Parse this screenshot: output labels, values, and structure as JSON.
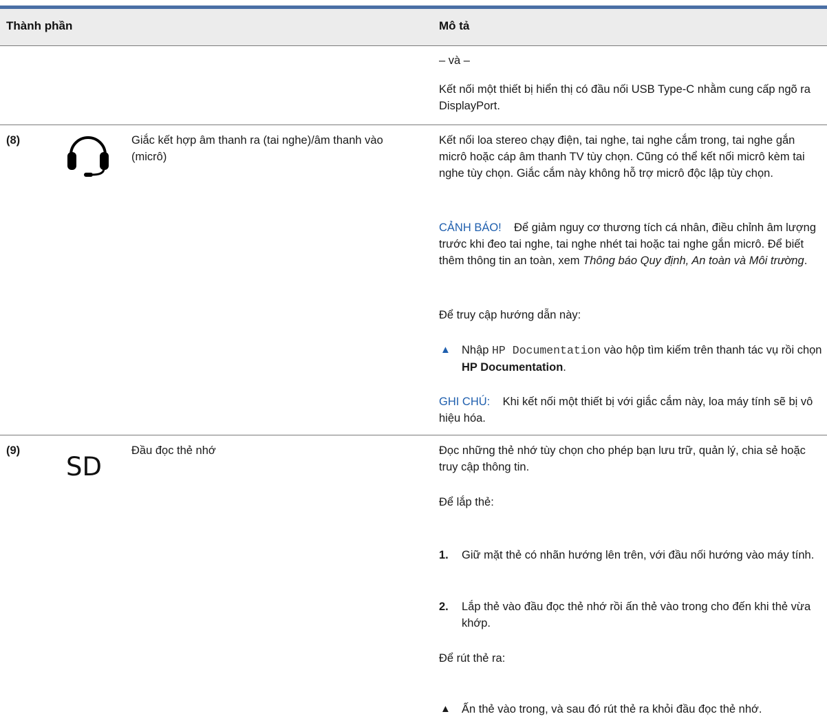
{
  "header": {
    "col_component": "Thành phần",
    "col_description": "Mô tả"
  },
  "row_prev": {
    "and_text": "– và –",
    "desc": "Kết nối một thiết bị hiển thị có đầu nối USB Type-C nhằm cung cấp ngõ ra DisplayPort."
  },
  "row8": {
    "number": "(8)",
    "icon": "headset-icon",
    "name": "Giắc kết hợp âm thanh ra (tai nghe)/âm thanh vào (micrô)",
    "desc": "Kết nối loa stereo chạy điện, tai nghe, tai nghe cắm trong, tai nghe gắn micrô hoặc cáp âm thanh TV tùy chọn. Cũng có thể kết nối micrô kèm tai nghe tùy chọn. Giắc cắm này không hỗ trợ micrô độc lập tùy chọn.",
    "warning_label": "CẢNH BÁO!",
    "warning_text": "Để giảm nguy cơ thương tích cá nhân, điều chỉnh âm lượng trước khi đeo tai nghe, tai nghe nhét tai hoặc tai nghe gắn micrô. Để biết thêm thông tin an toàn, xem ",
    "warning_ref": "Thông báo Quy định, An toàn và Môi trường",
    "warning_end": ".",
    "access_text": "Để truy cập hướng dẫn này:",
    "step_pre": "Nhập ",
    "step_code": "HP Documentation",
    "step_mid": " vào hộp tìm kiếm trên thanh tác vụ rồi chọn ",
    "step_bold": "HP Documentation",
    "step_end": ".",
    "note_label": "GHI CHÚ:",
    "note_text": "Khi kết nối một thiết bị với giắc cắm này, loa máy tính sẽ bị vô hiệu hóa."
  },
  "row9": {
    "number": "(9)",
    "icon_text": "SD",
    "name": "Đầu đọc thẻ nhớ",
    "desc": "Đọc những thẻ nhớ tùy chọn cho phép bạn lưu trữ, quản lý, chia sẻ hoặc truy cập thông tin.",
    "insert_title": "Để lắp thẻ:",
    "steps": [
      {
        "num": "1.",
        "text": "Giữ mặt thẻ có nhãn hướng lên trên, với đầu nối hướng vào máy tính."
      },
      {
        "num": "2.",
        "text": "Lắp thẻ vào đầu đọc thẻ nhớ rồi ấn thẻ vào trong cho đến khi thẻ vừa khớp."
      }
    ],
    "remove_title": "Để rút thẻ ra:",
    "remove_step": "Ấn thẻ vào trong, và sau đó rút thẻ ra khỏi đầu đọc thẻ nhớ."
  },
  "colors": {
    "accent": "#1f5fae",
    "bar": "#4a6fa5",
    "header_bg": "#ececec"
  }
}
